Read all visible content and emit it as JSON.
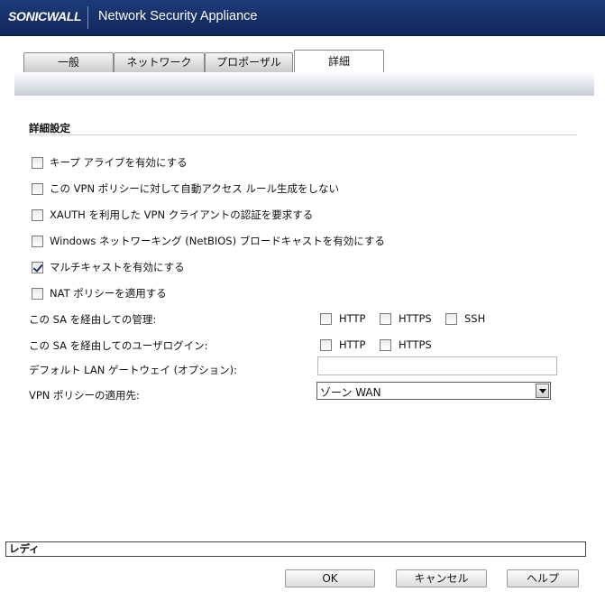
{
  "header": {
    "logo": "SONICWALL",
    "title": "Network Security Appliance"
  },
  "tabs": [
    {
      "label": "一般",
      "active": false
    },
    {
      "label": "ネットワーク",
      "active": false
    },
    {
      "label": "プロポーザル",
      "active": false
    },
    {
      "label": "詳細",
      "active": true
    }
  ],
  "section": {
    "title": "詳細設定"
  },
  "options": [
    {
      "label": "キープ アライブを有効にする",
      "checked": false
    },
    {
      "label": "この VPN ポリシーに対して自動アクセス ルール生成をしない",
      "checked": false
    },
    {
      "label": "XAUTH を利用した VPN クライアントの認証を要求する",
      "checked": false
    },
    {
      "label": "Windows ネットワーキング (NetBIOS) ブロードキャストを有効にする",
      "checked": false
    },
    {
      "label": "マルチキャストを有効にする",
      "checked": true
    },
    {
      "label": "NAT ポリシーを適用する",
      "checked": false
    }
  ],
  "management": {
    "label": "この SA を経由しての管理:",
    "items": [
      {
        "label": "HTTP",
        "checked": false
      },
      {
        "label": "HTTPS",
        "checked": false
      },
      {
        "label": "SSH",
        "checked": false
      }
    ]
  },
  "user_login": {
    "label": "この SA を経由してのユーザログイン:",
    "items": [
      {
        "label": "HTTP",
        "checked": false
      },
      {
        "label": "HTTPS",
        "checked": false
      }
    ]
  },
  "default_gateway": {
    "label": "デフォルト LAN ゲートウェイ (オプション):",
    "value": ""
  },
  "apply_to": {
    "label": "VPN ポリシーの適用先:",
    "value": "ゾーン WAN"
  },
  "status": "レディ",
  "buttons": {
    "ok": "OK",
    "cancel": "キャンセル",
    "help": "ヘルプ"
  }
}
